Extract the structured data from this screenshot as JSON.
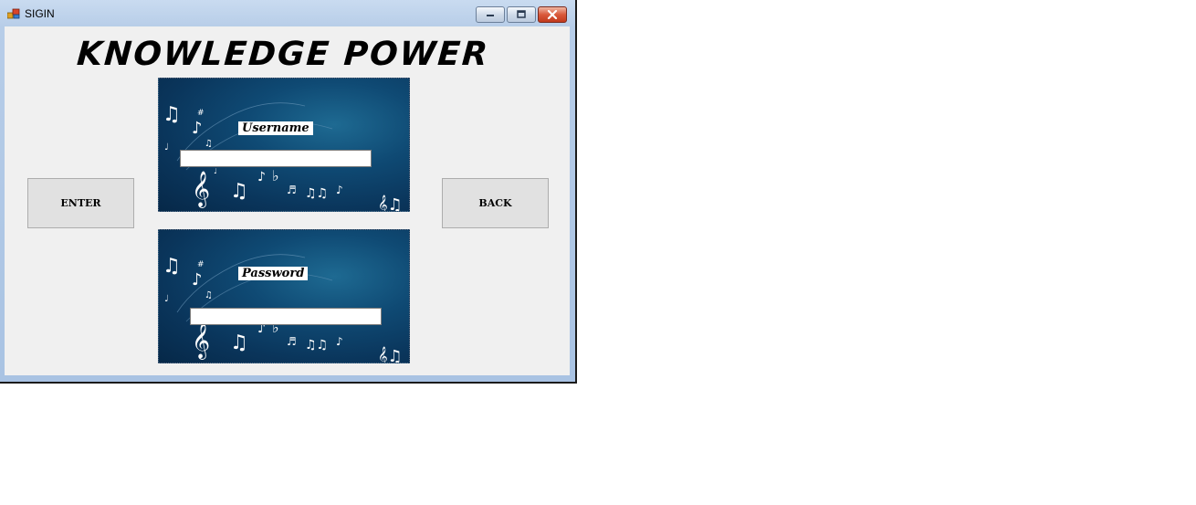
{
  "window": {
    "title": "SIGIN",
    "controls": {
      "minimize_icon": "minimize-icon",
      "maximize_icon": "maximize-icon",
      "close_icon": "close-icon"
    }
  },
  "header": {
    "title": "KNOWLEDGE POWER"
  },
  "buttons": {
    "enter_label": "ENTER",
    "back_label": "BACK"
  },
  "username": {
    "label": "Username",
    "value": ""
  },
  "password": {
    "label": "Password",
    "value": ""
  },
  "colors": {
    "panel_bg": "#0a355b",
    "close_button": "#c13a1d",
    "client_bg": "#f0f0f0"
  }
}
